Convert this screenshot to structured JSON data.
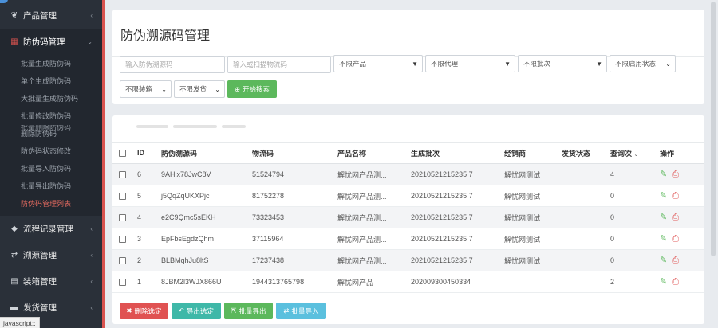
{
  "sidebar": {
    "groups": [
      {
        "label": "产品管理",
        "icon": "leaf-icon",
        "chevron": "‹"
      },
      {
        "label": "防伪码管理",
        "icon": "grid-icon",
        "chevron": "⌄"
      },
      {
        "label": "流程记录管理",
        "icon": "tag-icon",
        "chevron": "‹"
      },
      {
        "label": "溯源管理",
        "icon": "retweet-icon",
        "chevron": "‹"
      },
      {
        "label": "装箱管理",
        "icon": "th-icon",
        "chevron": "‹"
      },
      {
        "label": "发货管理",
        "icon": "truck-icon",
        "chevron": "‹"
      }
    ],
    "subitems": [
      "批量生成防伪码",
      "单个生成防伪码",
      "大批量生成防伪码",
      "批量修改防伪码",
      "删除防伪码",
      "防伪码状态修改",
      "批量导入防伪码",
      "批量导出防伪码",
      "防伪码管理列表"
    ],
    "overlap_ghost": "批量删除防伪码",
    "status_text": "javascript:;"
  },
  "page": {
    "title": "防伪溯源码管理"
  },
  "filters": {
    "code_placeholder": "输入防伪溯源码",
    "logistics_placeholder": "输入或扫描物流码",
    "product": "不限产品",
    "agent": "不限代理",
    "batch": "不限批次",
    "enable_status": "不限启用状态",
    "packing": "不限装箱",
    "shipping": "不限发货",
    "search_button": "开始搜索"
  },
  "table": {
    "headers": [
      "ID",
      "防伪溯源码",
      "物流码",
      "产品名称",
      "生成批次",
      "经销商",
      "发货状态",
      "查询次",
      "操作"
    ],
    "rows": [
      {
        "id": "6",
        "code": "9AHjx78JwC8V",
        "logistics": "51524794",
        "product": "解忧网产品测...",
        "batch": "20210521215235 7",
        "dealer": "解忧网测试",
        "ship": "",
        "queries": "4"
      },
      {
        "id": "5",
        "code": "j5QqZqUKXPjc",
        "logistics": "81752278",
        "product": "解忧网产品测...",
        "batch": "20210521215235 7",
        "dealer": "解忧网测试",
        "ship": "",
        "queries": "0"
      },
      {
        "id": "4",
        "code": "e2C9Qmc5sEKH",
        "logistics": "73323453",
        "product": "解忧网产品测...",
        "batch": "20210521215235 7",
        "dealer": "解忧网测试",
        "ship": "",
        "queries": "0"
      },
      {
        "id": "3",
        "code": "EpFbsEgdzQhm",
        "logistics": "37115964",
        "product": "解忧网产品测...",
        "batch": "20210521215235 7",
        "dealer": "解忧网测试",
        "ship": "",
        "queries": "0"
      },
      {
        "id": "2",
        "code": "BLBMqhJu8ltS",
        "logistics": "17237438",
        "product": "解忧网产品测...",
        "batch": "20210521215235 7",
        "dealer": "解忧网测试",
        "ship": "",
        "queries": "0"
      },
      {
        "id": "1",
        "code": "8JBM2l3WJX866U",
        "logistics": "1944313765798",
        "product": "解忧网产品",
        "batch": "202009300450334",
        "dealer": "",
        "ship": "",
        "queries": "2"
      }
    ]
  },
  "actions": {
    "delete": "删除选定",
    "export_selected": "导出选定",
    "bulk_export": "批量导出",
    "bulk_import": "批量导入"
  },
  "colors": {
    "sidebar_bg": "#2a3039",
    "accent_red": "#d9534f",
    "green": "#5cb85c",
    "teal": "#3fb8a8",
    "blue": "#5bc0de"
  }
}
